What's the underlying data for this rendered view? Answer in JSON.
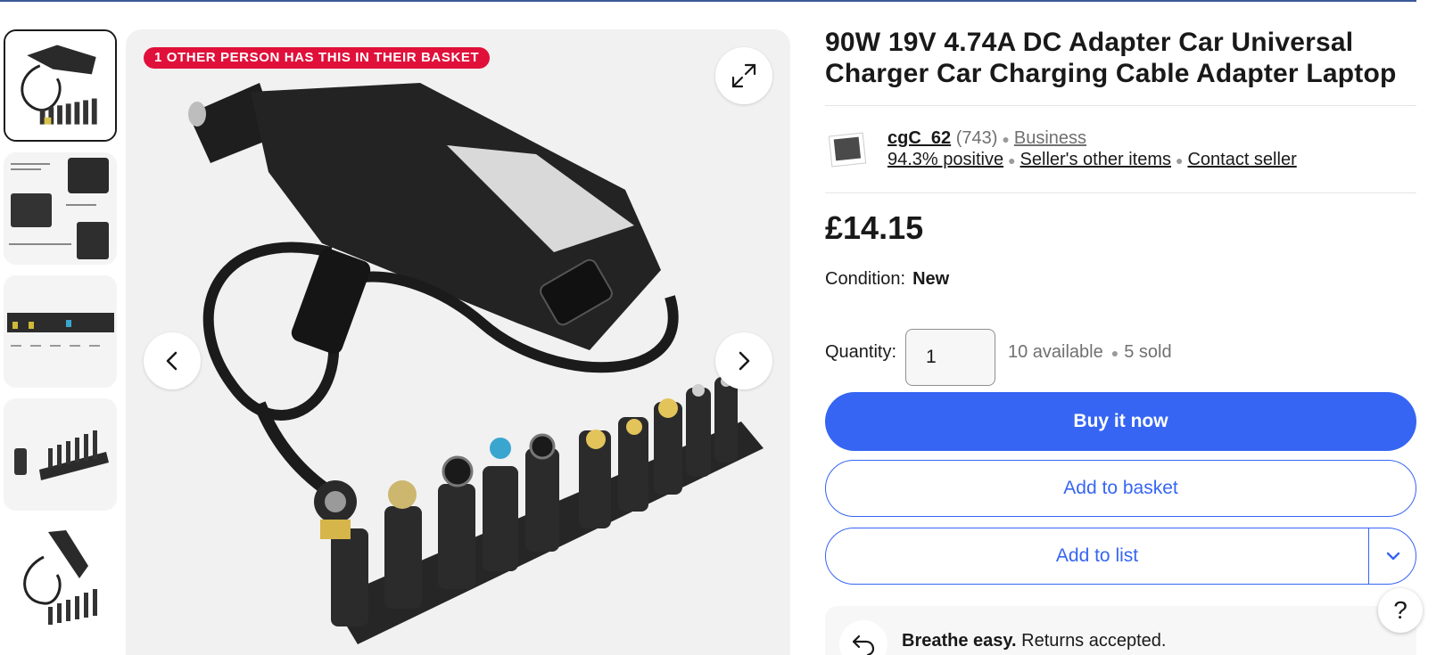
{
  "badge": "1 OTHER PERSON HAS THIS IN THEIR BASKET",
  "title": "90W 19V 4.74A DC Adapter Car Universal Charger Car Charging Cable Adapter Laptop",
  "seller": {
    "name": "cgC_62",
    "feedback_count": "(743)",
    "type": "Business",
    "positive": "94.3% positive",
    "other_items": "Seller's other items",
    "contact": "Contact seller"
  },
  "price": "£14.15",
  "condition": {
    "label": "Condition:",
    "value": "New"
  },
  "quantity": {
    "label": "Quantity:",
    "value": "1",
    "available": "10 available",
    "sold": "5 sold"
  },
  "buttons": {
    "buy_now": "Buy it now",
    "add_basket": "Add to basket",
    "add_list": "Add to list"
  },
  "returns": {
    "bold": "Breathe easy.",
    "text": "Returns accepted."
  },
  "help": "?",
  "thumbnails": [
    {
      "name": "thumbnail-1",
      "active": true
    },
    {
      "name": "thumbnail-2",
      "active": false
    },
    {
      "name": "thumbnail-3",
      "active": false
    },
    {
      "name": "thumbnail-4",
      "active": false
    },
    {
      "name": "thumbnail-5",
      "active": false
    }
  ],
  "icons": {
    "expand": "expand-icon",
    "prev": "chevron-left-icon",
    "next": "chevron-right-icon",
    "dropdown": "chevron-down-icon",
    "returns": "return-arrow-icon"
  },
  "colors": {
    "accent": "#3665f3",
    "badge": "#e0103a",
    "text": "#191919",
    "muted": "#707070"
  }
}
